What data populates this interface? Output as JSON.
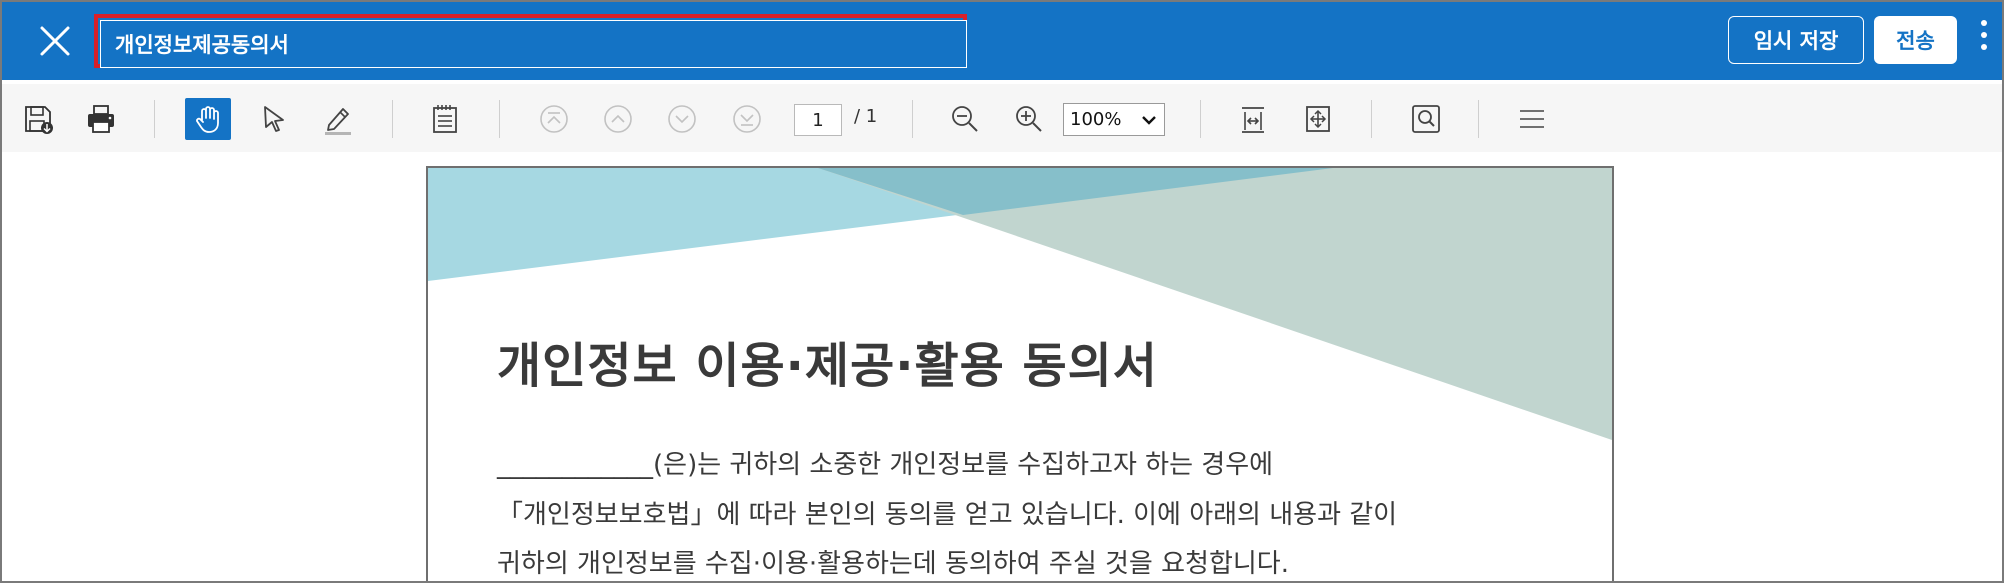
{
  "header": {
    "close_icon": "close-icon",
    "title_value": "개인정보제공동의서",
    "temp_save_label": "임시 저장",
    "send_label": "전송",
    "more_icon": "more-vertical-icon",
    "accent_color": "#1473c5",
    "highlight_color": "#d8202a"
  },
  "toolbar": {
    "icons": [
      "save-icon",
      "print-icon",
      "hand-tool-icon",
      "select-pointer-icon",
      "highlighter-icon",
      "notes-icon",
      "first-page-icon",
      "previous-page-icon",
      "next-page-icon",
      "last-page-icon",
      "zoom-out-icon",
      "zoom-in-icon",
      "fit-width-icon",
      "fit-page-icon",
      "search-icon",
      "menu-icon"
    ],
    "active_tool": "hand-tool-icon",
    "current_page": "1",
    "page_separator_total": "/  1",
    "zoom_value": "100%"
  },
  "document": {
    "title": "개인정보 이용·제공·활용 동의서",
    "line1": "____________(은)는 귀하의 소중한 개인정보를 수집하고자 하는 경우에",
    "line2": "「개인정보보호법」에 따라 본인의 동의를 얻고 있습니다. 이에 아래의 내용과 같이",
    "line3": "귀하의 개인정보를 수집·이용·활용하는데 동의하여 주실 것을 요청합니다.",
    "decor_colors": [
      "#a6d8e2",
      "#c1d5cf",
      "#86bfca"
    ]
  }
}
